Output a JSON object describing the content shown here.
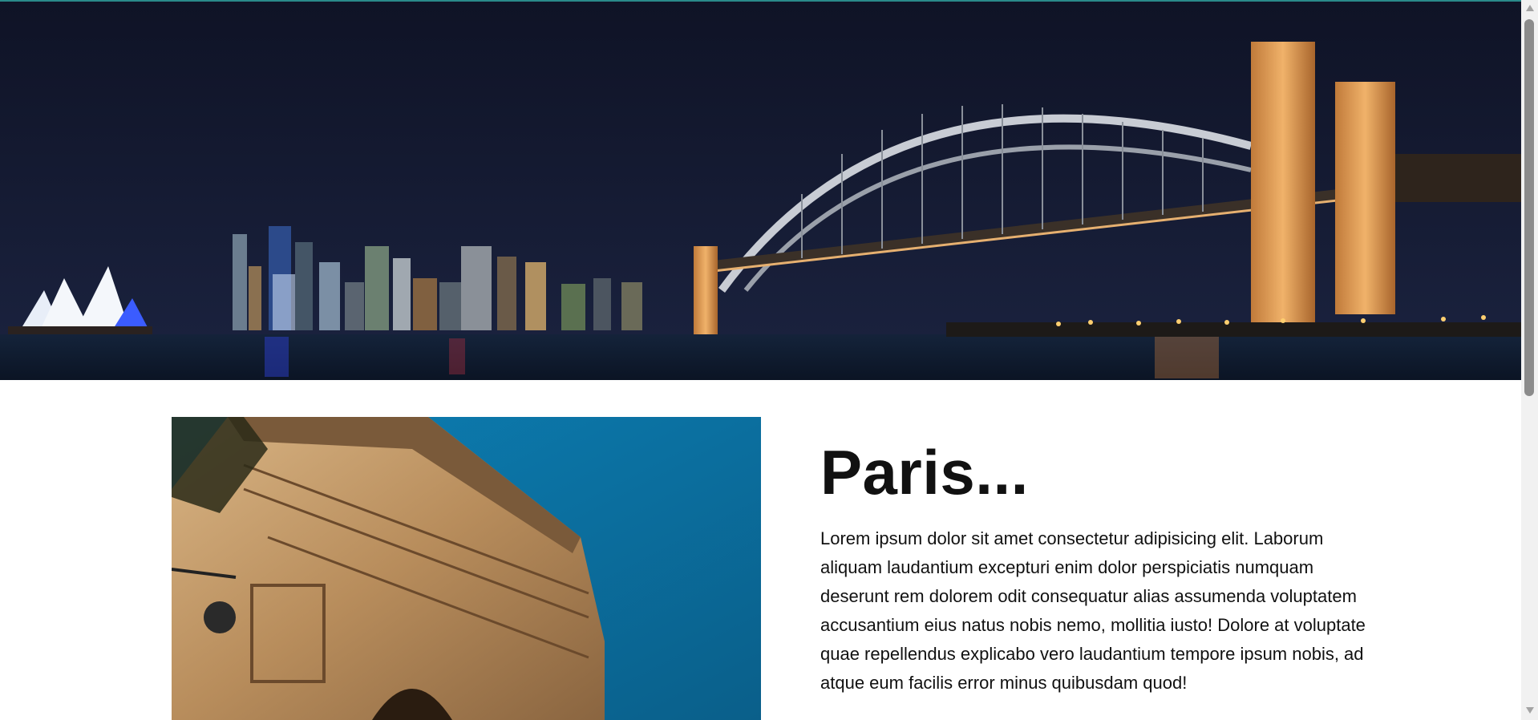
{
  "hero": {
    "image": "sydney-harbour-bridge-night-panorama",
    "sky_color": "#0f1428"
  },
  "city": {
    "title": "Paris...",
    "description": "Lorem ipsum dolor sit amet consectetur adipisicing elit. Laborum aliquam laudantium excepturi enim dolor perspiciatis numquam deserunt rem dolorem odit consequatur alias assumenda voluptatem accusantium eius natus nobis nemo, mollitia iusto! Dolore at voluptate quae repellendus explicabo vero laudantium tempore ipsum nobis, ad atque eum facilis error minus quibusdam quod!",
    "image": "arc-de-triomphe-photo",
    "sky_color": "#0a7fb0"
  }
}
